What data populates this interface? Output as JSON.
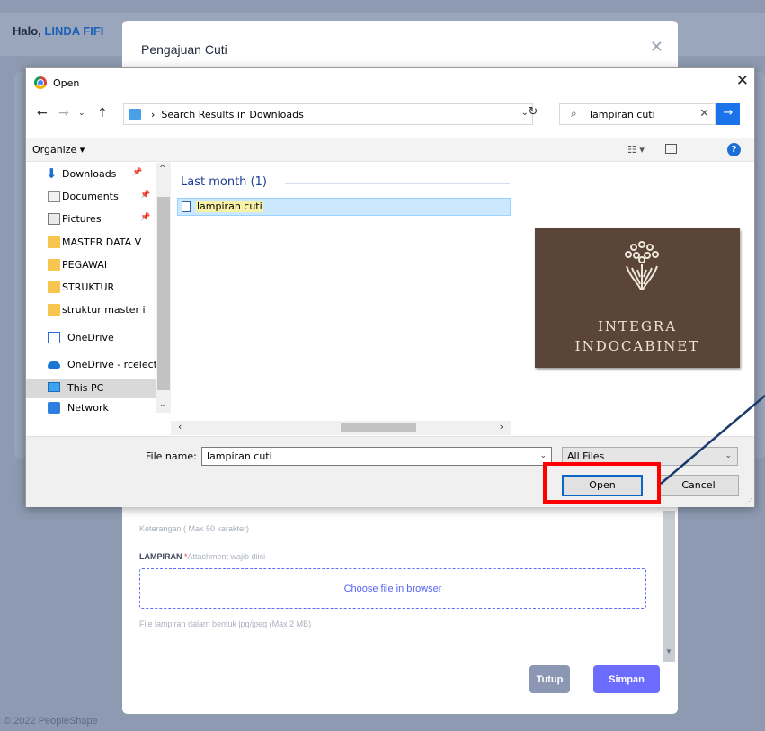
{
  "background": {
    "greeting_prefix": "Halo,",
    "user_name": "LINDA FIFI",
    "footer": "© 2022 PeopleShape"
  },
  "modal": {
    "title": "Pengajuan Cuti",
    "close_icon": "close-icon",
    "keterangan_label": "Keterangan ( Max 50 karakter)",
    "lampiran_label": "LAMPIRAN",
    "lampiran_required_mark": "*",
    "lampiran_hint": "Attachment wajib diisi",
    "dropzone_text": "Choose file in browser",
    "file_hint": "File lampiran dalam bentuk jpg/jpeg (Max 2 MB)",
    "buttons": {
      "tutup": "Tutup",
      "simpan": "Simpan"
    },
    "colors": {
      "simpan": "#6c6cff",
      "tutup": "#8b97b3",
      "dropzone": "#5b6cff"
    }
  },
  "dialog": {
    "title": "Open",
    "address": {
      "separator": "›",
      "path": "Search Results in Downloads"
    },
    "search": {
      "value": "lampiran cuti"
    },
    "toolbar": {
      "organize": "Organize ▾"
    },
    "nav_items": [
      {
        "label": "Downloads",
        "icon": "download-arrow-icon",
        "pinned": true
      },
      {
        "label": "Documents",
        "icon": "document-icon",
        "pinned": true
      },
      {
        "label": "Pictures",
        "icon": "pictures-icon",
        "pinned": true
      },
      {
        "label": "MASTER DATA V",
        "icon": "folder-icon",
        "pinned": false
      },
      {
        "label": "PEGAWAI",
        "icon": "folder-icon",
        "pinned": false
      },
      {
        "label": "STRUKTUR",
        "icon": "folder-icon",
        "pinned": false
      },
      {
        "label": "struktur master i",
        "icon": "folder-icon",
        "pinned": false
      },
      {
        "label": "OneDrive",
        "icon": "onedrive-icon",
        "pinned": false
      },
      {
        "label": "OneDrive - rcelect",
        "icon": "cloud-icon",
        "pinned": false
      },
      {
        "label": "This PC",
        "icon": "computer-icon",
        "pinned": false,
        "selected": true
      },
      {
        "label": "Network",
        "icon": "network-icon",
        "pinned": false
      }
    ],
    "group_header": "Last month (1)",
    "files": [
      {
        "name": "lampiran cuti",
        "icon": "file-icon",
        "selected": true
      }
    ],
    "preview": {
      "line1": "INTEGRA",
      "line2": "INDOCABINET",
      "background": "#5b4538"
    },
    "file_name_label": "File name:",
    "file_name_value": "lampiran cuti",
    "filter_value": "All Files",
    "buttons": {
      "open": "Open",
      "cancel": "Cancel"
    },
    "accent": "#1a73e8"
  },
  "annotation": {
    "highlight_color": "#ff0000",
    "arrow_color": "#1a3a6b"
  }
}
